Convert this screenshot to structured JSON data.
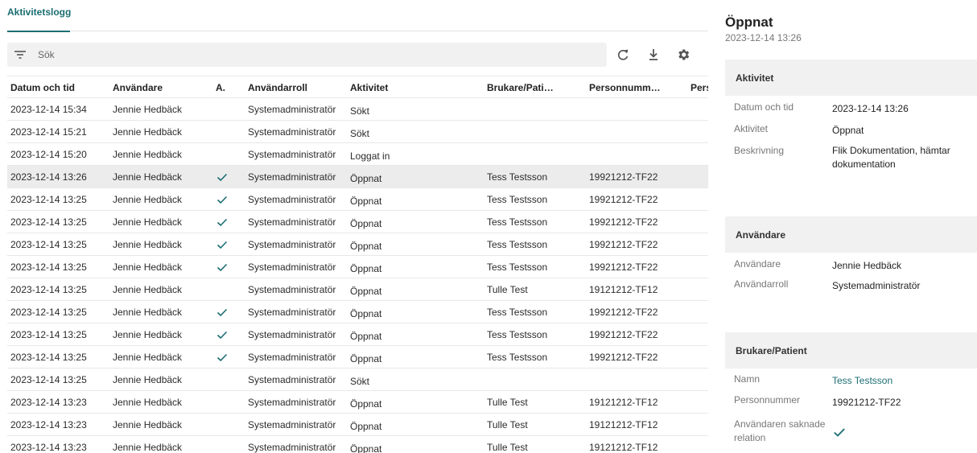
{
  "tabs": [
    {
      "label": "Aktivitetslogg",
      "active": true
    }
  ],
  "search": {
    "placeholder": "Sök"
  },
  "toolbar": {
    "refresh_icon": "refresh-icon",
    "download_icon": "download-icon",
    "settings_icon": "gear-icon"
  },
  "table": {
    "columns": [
      "Datum och tid",
      "Användare",
      "A.",
      "Användarroll",
      "Aktivitet",
      "Brukare/Pati…",
      "Personnumm…",
      "Pers"
    ],
    "rows": [
      {
        "date": "2023-12-14 15:34",
        "user": "Jennie Hedbäck",
        "check": false,
        "role": "Systemadministratör",
        "activity": "Sökt",
        "patient": "",
        "pnr": "",
        "selected": false
      },
      {
        "date": "2023-12-14 15:21",
        "user": "Jennie Hedbäck",
        "check": false,
        "role": "Systemadministratör",
        "activity": "Sökt",
        "patient": "",
        "pnr": "",
        "selected": false
      },
      {
        "date": "2023-12-14 15:20",
        "user": "Jennie Hedbäck",
        "check": false,
        "role": "Systemadministratör",
        "activity": "Loggat in",
        "patient": "",
        "pnr": "",
        "selected": false
      },
      {
        "date": "2023-12-14 13:26",
        "user": "Jennie Hedbäck",
        "check": true,
        "role": "Systemadministratör",
        "activity": "Öppnat",
        "patient": "Tess Testsson",
        "pnr": "19921212-TF22",
        "selected": true
      },
      {
        "date": "2023-12-14 13:25",
        "user": "Jennie Hedbäck",
        "check": true,
        "role": "Systemadministratör",
        "activity": "Öppnat",
        "patient": "Tess Testsson",
        "pnr": "19921212-TF22",
        "selected": false
      },
      {
        "date": "2023-12-14 13:25",
        "user": "Jennie Hedbäck",
        "check": true,
        "role": "Systemadministratör",
        "activity": "Öppnat",
        "patient": "Tess Testsson",
        "pnr": "19921212-TF22",
        "selected": false
      },
      {
        "date": "2023-12-14 13:25",
        "user": "Jennie Hedbäck",
        "check": true,
        "role": "Systemadministratör",
        "activity": "Öppnat",
        "patient": "Tess Testsson",
        "pnr": "19921212-TF22",
        "selected": false
      },
      {
        "date": "2023-12-14 13:25",
        "user": "Jennie Hedbäck",
        "check": true,
        "role": "Systemadministratör",
        "activity": "Öppnat",
        "patient": "Tess Testsson",
        "pnr": "19921212-TF22",
        "selected": false
      },
      {
        "date": "2023-12-14 13:25",
        "user": "Jennie Hedbäck",
        "check": false,
        "role": "Systemadministratör",
        "activity": "Öppnat",
        "patient": "Tulle Test",
        "pnr": "19121212-TF12",
        "selected": false
      },
      {
        "date": "2023-12-14 13:25",
        "user": "Jennie Hedbäck",
        "check": true,
        "role": "Systemadministratör",
        "activity": "Öppnat",
        "patient": "Tess Testsson",
        "pnr": "19921212-TF22",
        "selected": false
      },
      {
        "date": "2023-12-14 13:25",
        "user": "Jennie Hedbäck",
        "check": true,
        "role": "Systemadministratör",
        "activity": "Öppnat",
        "patient": "Tess Testsson",
        "pnr": "19921212-TF22",
        "selected": false
      },
      {
        "date": "2023-12-14 13:25",
        "user": "Jennie Hedbäck",
        "check": true,
        "role": "Systemadministratör",
        "activity": "Öppnat",
        "patient": "Tess Testsson",
        "pnr": "19921212-TF22",
        "selected": false
      },
      {
        "date": "2023-12-14 13:25",
        "user": "Jennie Hedbäck",
        "check": false,
        "role": "Systemadministratör",
        "activity": "Sökt",
        "patient": "",
        "pnr": "",
        "selected": false
      },
      {
        "date": "2023-12-14 13:23",
        "user": "Jennie Hedbäck",
        "check": false,
        "role": "Systemadministratör",
        "activity": "Öppnat",
        "patient": "Tulle Test",
        "pnr": "19121212-TF12",
        "selected": false
      },
      {
        "date": "2023-12-14 13:23",
        "user": "Jennie Hedbäck",
        "check": false,
        "role": "Systemadministratör",
        "activity": "Öppnat",
        "patient": "Tulle Test",
        "pnr": "19121212-TF12",
        "selected": false
      },
      {
        "date": "2023-12-14 13:23",
        "user": "Jennie Hedbäck",
        "check": false,
        "role": "Systemadministratör",
        "activity": "Öppnat",
        "patient": "Tulle Test",
        "pnr": "19121212-TF12",
        "selected": false
      }
    ]
  },
  "detail": {
    "title": "Öppnat",
    "subtitle": "2023-12-14 13:26",
    "activity": {
      "heading": "Aktivitet",
      "date_label": "Datum och tid",
      "date_value": "2023-12-14 13:26",
      "activity_label": "Aktivitet",
      "activity_value": "Öppnat",
      "desc_label": "Beskrivning",
      "desc_value": "Flik Dokumentation, hämtar dokumentation"
    },
    "user": {
      "heading": "Användare",
      "user_label": "Användare",
      "user_value": "Jennie Hedbäck",
      "role_label": "Användarroll",
      "role_value": "Systemadministratör"
    },
    "patient": {
      "heading": "Brukare/Patient",
      "name_label": "Namn",
      "name_value": "Tess Testsson",
      "pnr_label": "Personnummer",
      "pnr_value": "19921212-TF22",
      "missing_label": "Användaren saknade relation",
      "missing_value": true
    }
  },
  "colors": {
    "accent": "#1c6e73",
    "selected_row": "#ececec",
    "search_bg": "#f1f1f1"
  }
}
